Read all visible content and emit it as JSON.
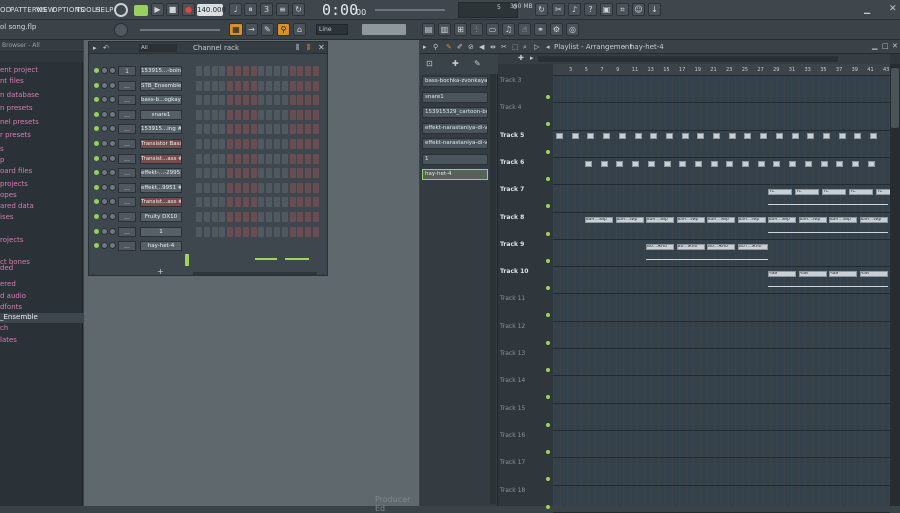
{
  "menu": {
    "tools_left": "OD",
    "patterns": "PATTERNS",
    "view": "VIEW",
    "options": "OPTIONS",
    "tools": "TOOLS",
    "help": "HELP"
  },
  "transport": {
    "tempo": "140.000",
    "time": "0:00",
    "time_small": "00",
    "line_mode": "Line",
    "cpu": "5",
    "mem": "390 MB",
    "mem_small": "0"
  },
  "project": {
    "file": "ol song.flp"
  },
  "browser": {
    "header": "Browser - All",
    "items": [
      {
        "label": "ent project",
        "dim": false
      },
      {
        "label": "nt files",
        "dim": false
      },
      {
        "label": "n database",
        "dim": false
      },
      {
        "label": "n presets",
        "dim": false
      },
      {
        "label": "nel presets",
        "dim": false
      },
      {
        "label": "r presets",
        "dim": false
      },
      {
        "label": "s",
        "dim": false
      },
      {
        "label": "p",
        "dim": false
      },
      {
        "label": "oard files",
        "dim": false
      },
      {
        "label": "projects",
        "dim": false
      },
      {
        "label": "opes",
        "dim": false
      },
      {
        "label": "ared data",
        "dim": false
      },
      {
        "label": "ises",
        "dim": false
      },
      {
        "label": "rojects",
        "dim": false
      },
      {
        "label": "ct bones",
        "dim": false
      },
      {
        "label": "ded",
        "dim": false
      },
      {
        "label": "ered",
        "dim": false
      },
      {
        "label": "d audio",
        "dim": false
      },
      {
        "label": "dfonts",
        "dim": false
      },
      {
        "label": "_Ensemble",
        "dim": false,
        "hl": true
      },
      {
        "label": "ch",
        "dim": false
      },
      {
        "label": "lates",
        "dim": false
      }
    ]
  },
  "channel_rack": {
    "title": "Channel rack",
    "filter": "All",
    "channels": [
      {
        "num": "1",
        "name": "153915...-boing",
        "red": false
      },
      {
        "num": "...",
        "name": "STB_Ensemble",
        "red": false
      },
      {
        "num": "...",
        "name": "bass-b...ogkaya",
        "red": false
      },
      {
        "num": "...",
        "name": "snare1",
        "red": false
      },
      {
        "num": "...",
        "name": "153915...ing #2",
        "red": false
      },
      {
        "num": "...",
        "name": "Transistor Bass",
        "red": true
      },
      {
        "num": "...",
        "name": "Transist...ass #3",
        "red": true
      },
      {
        "num": "...",
        "name": "effekt-...-29951",
        "red": false
      },
      {
        "num": "...",
        "name": "effekt...9951 #2",
        "red": false
      },
      {
        "num": "...",
        "name": "Transist...ass #2",
        "red": true
      },
      {
        "num": "...",
        "name": "Fruity DX10",
        "red": false
      },
      {
        "num": "...",
        "name": "1",
        "red": false
      },
      {
        "num": "...",
        "name": "hay-het-4",
        "red": false
      }
    ],
    "add": "+"
  },
  "playlist": {
    "title": "Playlist - Arrangement",
    "current_pattern": "hay-het-4",
    "patterns": [
      {
        "label": "bass-bochka-zvonkaya-...",
        "sel": false
      },
      {
        "label": "snare1",
        "sel": false
      },
      {
        "label": "153915329_cartoon-boi...",
        "sel": false
      },
      {
        "label": "effekt-narastaniya-di-vs...",
        "sel": false
      },
      {
        "label": "effekt-narastaniya-di-vs...",
        "sel": false
      },
      {
        "label": "1",
        "sel": false
      },
      {
        "label": "hay-het-4",
        "sel": true
      }
    ],
    "ruler": [
      "3",
      "5",
      "7",
      "9",
      "11",
      "13",
      "15",
      "17",
      "19",
      "21",
      "23",
      "25",
      "27",
      "29",
      "31",
      "33",
      "35",
      "37",
      "39",
      "41",
      "43"
    ],
    "tracks": [
      {
        "label": "Track 3",
        "bold": false
      },
      {
        "label": "Track 4",
        "bold": false
      },
      {
        "label": "Track 5",
        "bold": true
      },
      {
        "label": "Track 6",
        "bold": true
      },
      {
        "label": "Track 7",
        "bold": true
      },
      {
        "label": "Track 8",
        "bold": true
      },
      {
        "label": "Track 9",
        "bold": true
      },
      {
        "label": "Track 10",
        "bold": true
      },
      {
        "label": "Track 11",
        "bold": false
      },
      {
        "label": "Track 12",
        "bold": false
      },
      {
        "label": "Track 13",
        "bold": false
      },
      {
        "label": "Track 14",
        "bold": false
      },
      {
        "label": "Track 15",
        "bold": false
      },
      {
        "label": "Track 16",
        "bold": false
      },
      {
        "label": "Track 17",
        "bold": false
      },
      {
        "label": "Track 18",
        "bold": false
      }
    ],
    "clip_labels": {
      "t7": "TC",
      "t8": "ван...эйр",
      "t9": "Во...жно",
      "t9b": "Вот...жно",
      "t10": "чай"
    }
  },
  "footer": {
    "watermark": "Producer Ed"
  }
}
